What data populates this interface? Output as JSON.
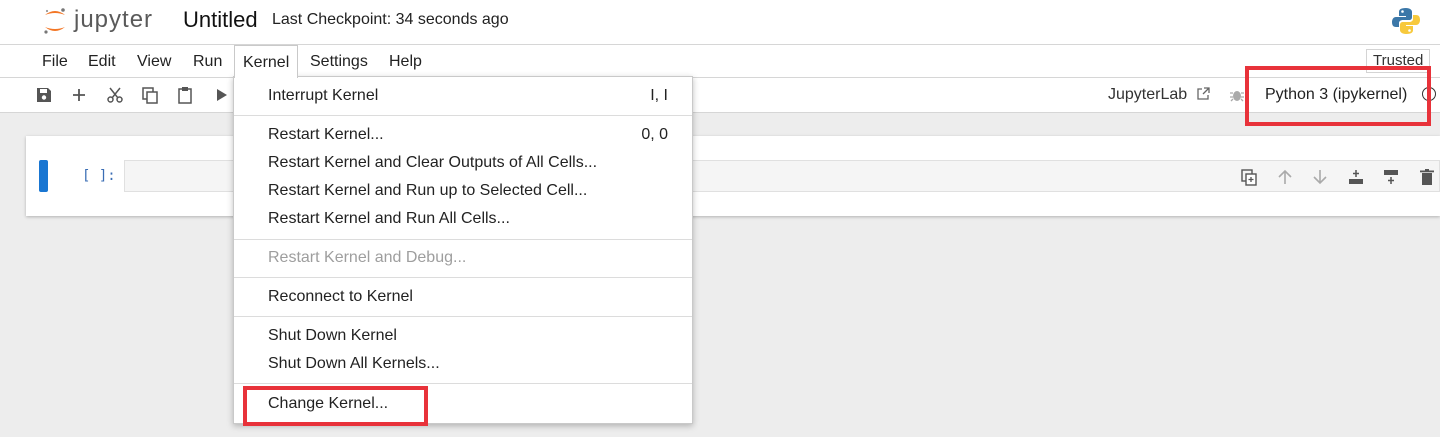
{
  "header": {
    "logo_text": "jupyter",
    "notebook_title": "Untitled",
    "checkpoint": "Last Checkpoint: 34 seconds ago"
  },
  "menubar": {
    "items": [
      "File",
      "Edit",
      "View",
      "Run",
      "Kernel",
      "Settings",
      "Help"
    ],
    "active": "Kernel",
    "trusted_label": "Trusted"
  },
  "toolbar": {
    "icons": [
      "save-icon",
      "add-icon",
      "cut-icon",
      "copy-icon",
      "paste-icon",
      "run-icon"
    ],
    "jupyterlab_label": "JupyterLab",
    "kernel_name": "Python 3 (ipykernel)"
  },
  "cell": {
    "prompt": "[ ]:",
    "tools": [
      "duplicate-icon",
      "move-up-icon",
      "move-down-icon",
      "insert-above-icon",
      "insert-below-icon",
      "delete-icon"
    ]
  },
  "kernel_menu": {
    "items": [
      {
        "label": "Interrupt Kernel",
        "shortcut": "I, I",
        "disabled": false
      },
      {
        "label": "Restart Kernel...",
        "shortcut": "0, 0",
        "disabled": false
      },
      {
        "label": "Restart Kernel and Clear Outputs of All Cells...",
        "shortcut": "",
        "disabled": false
      },
      {
        "label": "Restart Kernel and Run up to Selected Cell...",
        "shortcut": "",
        "disabled": false
      },
      {
        "label": "Restart Kernel and Run All Cells...",
        "shortcut": "",
        "disabled": false
      },
      {
        "label": "Restart Kernel and Debug...",
        "shortcut": "",
        "disabled": true
      },
      {
        "label": "Reconnect to Kernel",
        "shortcut": "",
        "disabled": false
      },
      {
        "label": "Shut Down Kernel",
        "shortcut": "",
        "disabled": false
      },
      {
        "label": "Shut Down All Kernels...",
        "shortcut": "",
        "disabled": false
      },
      {
        "label": "Change Kernel...",
        "shortcut": "",
        "disabled": false
      }
    ]
  },
  "colors": {
    "highlight": "#e8323a",
    "accent": "#1976d2",
    "logo_orange": "#f37726"
  }
}
